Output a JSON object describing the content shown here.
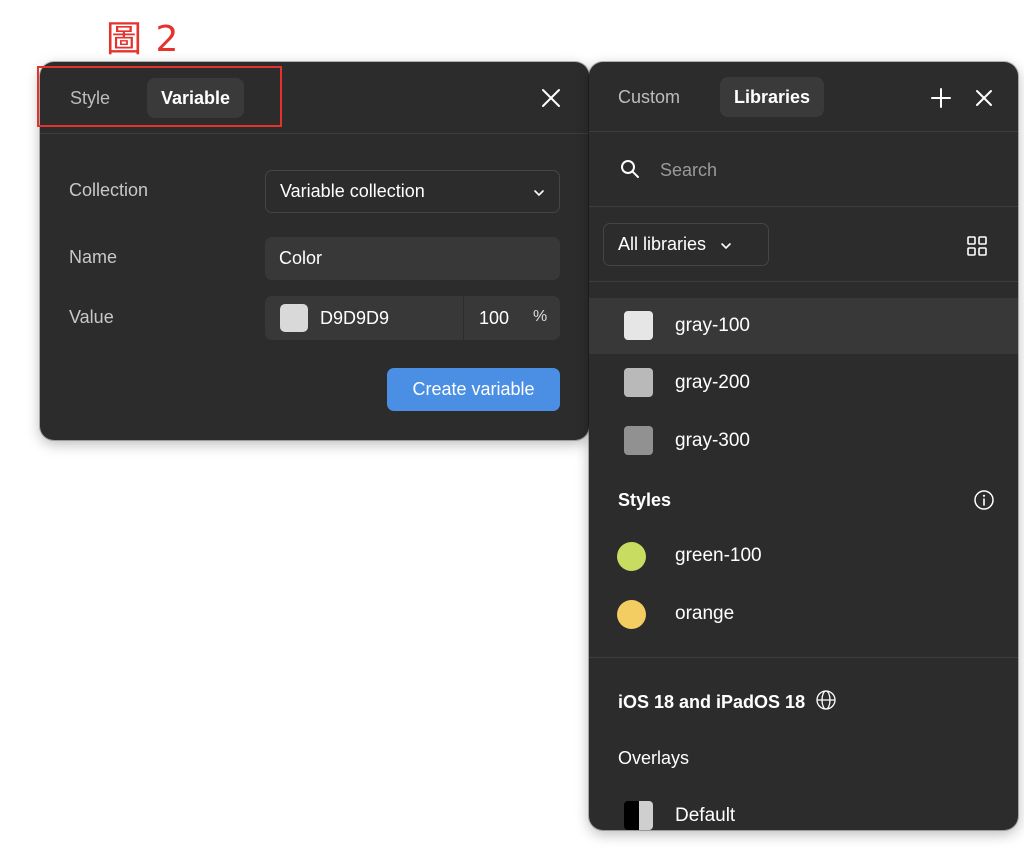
{
  "figure_label": "圖 2",
  "variable_panel": {
    "tabs": [
      {
        "label": "Style",
        "active": false
      },
      {
        "label": "Variable",
        "active": true
      }
    ],
    "close_icon": "close-icon",
    "collection": {
      "label": "Collection",
      "value": "Variable collection"
    },
    "name": {
      "label": "Name",
      "value": "Color"
    },
    "value": {
      "label": "Value",
      "hex": "D9D9D9",
      "swatch_color": "#d9d9d9",
      "opacity": "100",
      "opacity_unit": "%"
    },
    "create_button": "Create variable"
  },
  "libraries_panel": {
    "tabs": [
      {
        "label": "Custom",
        "active": false
      },
      {
        "label": "Libraries",
        "active": true
      }
    ],
    "add_icon": "plus-icon",
    "close_icon": "close-icon",
    "search_placeholder": "Search",
    "library_filter": "All libraries",
    "view_toggle_icon": "grid-view-icon",
    "variables": [
      {
        "name": "gray-100",
        "color": "#e6e6e6",
        "selected": true
      },
      {
        "name": "gray-200",
        "color": "#b9b9b9",
        "selected": false
      },
      {
        "name": "gray-300",
        "color": "#919191",
        "selected": false
      }
    ],
    "styles_heading": "Styles",
    "styles_info_icon": "info-icon",
    "styles": [
      {
        "name": "green-100",
        "color": "#c8dc62"
      },
      {
        "name": "orange",
        "color": "#f4cd62"
      }
    ],
    "library_name": "iOS 18 and iPadOS 18",
    "library_icon": "globe-icon",
    "overlays_heading": "Overlays",
    "overlays": [
      {
        "name": "Default"
      }
    ]
  },
  "colors": {
    "panel_bg": "#2c2c2c",
    "accent": "#4a8fe4",
    "annotation_red": "#e5322d"
  }
}
